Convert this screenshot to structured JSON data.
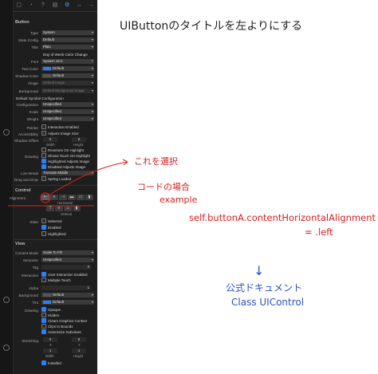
{
  "title_note": "UIButtonのタイトルを左よりにする",
  "inspector": {
    "tabs": [
      "▢",
      "◔",
      "?",
      "▤",
      "⚙",
      "↔",
      "→"
    ],
    "button_section": {
      "heading": "Button",
      "rows": [
        {
          "label": "Type",
          "value": "System"
        },
        {
          "label": "State Config",
          "value": "Default"
        },
        {
          "label": "Title",
          "value": "Plain"
        },
        {
          "label": "",
          "value": "Day of Week Color Change",
          "plain": true
        },
        {
          "label": "Font",
          "value": "System 15.0"
        },
        {
          "label": "Text Color",
          "value": "Default"
        },
        {
          "label": "Shadow Color",
          "value": "Default"
        },
        {
          "label": "Image",
          "value": "Default Image",
          "dim": true
        },
        {
          "label": "Background",
          "value": "Default Background Image",
          "dim": true
        }
      ],
      "symbol_heading": "Default Symbol Configuration",
      "symbol_rows": [
        {
          "label": "Configuration",
          "value": "Unspecified"
        },
        {
          "label": "Scale",
          "value": "Unspecified"
        },
        {
          "label": "Weight",
          "value": "Unspecified"
        }
      ],
      "pointer_label": "Pointer",
      "pointer_check": "Interaction Enabled",
      "accessibility_label": "Accessibility",
      "accessibility_check": "Adjusts Image Size",
      "shadow_offset_label": "Shadow Offset",
      "shadow_w": "0",
      "shadow_h": "0",
      "width_label": "Width",
      "height_label": "Height",
      "reverses": "Reverses On Highlight",
      "drawing_label": "Drawing",
      "touch": "Shows Touch On Highlight",
      "highlighted_adjusts": "Highlighted Adjusts Image",
      "disabled_adjusts": "Disabled Adjusts Image",
      "line_break_label": "Line Break",
      "line_break_value": "Truncate Middle",
      "drag_drop_label": "Drag and Drop",
      "spring_loaded": "Spring Loaded"
    },
    "control_section": {
      "heading": "Control",
      "alignment_label": "Alignment",
      "horizontal_label": "Horizontal",
      "vertical_label": "Vertical",
      "state_label": "State",
      "selected": "Selected",
      "enabled": "Enabled",
      "highlighted": "Highlighted"
    },
    "view_section": {
      "heading": "View",
      "rows": [
        {
          "label": "Content Mode",
          "value": "Scale To Fill"
        },
        {
          "label": "Semantic",
          "value": "Unspecified"
        },
        {
          "label": "Tag",
          "value": "0"
        }
      ],
      "interaction_label": "Interaction",
      "user_interaction": "User Interaction Enabled",
      "multiple_touch": "Multiple Touch",
      "alpha_label": "Alpha",
      "alpha_value": "1",
      "background_label": "Background",
      "background_value": "Default",
      "tint_label": "Tint",
      "tint_value": "Default",
      "drawing_label": "Drawing",
      "opaque": "Opaque",
      "hidden": "Hidden",
      "clears": "Clears Graphics Context",
      "clips": "Clips to Bounds",
      "autoresize": "Autoresize Subviews",
      "stretching_label": "Stretching",
      "s_x": "0",
      "s_y": "0",
      "s_w": "1",
      "s_h": "1",
      "x_label": "X",
      "y_label": "Y",
      "w_label": "Width",
      "h_label": "Height",
      "installed": "Installed"
    }
  },
  "annotations": {
    "this_one": "これを選択",
    "code_case": "コードの場合",
    "example": "example",
    "code_line1": "self.buttonA.contentHorizontalAlignment",
    "code_line2": "= .left",
    "down_arrow": "↓",
    "docs_line1": "公式ドキュメント",
    "docs_line2": "Class UIControl"
  },
  "colors": {
    "annotation_red": "#d42020",
    "annotation_blue": "#2952c4",
    "panel_bg": "#1e1e1e",
    "accent": "#2d7ff9"
  }
}
